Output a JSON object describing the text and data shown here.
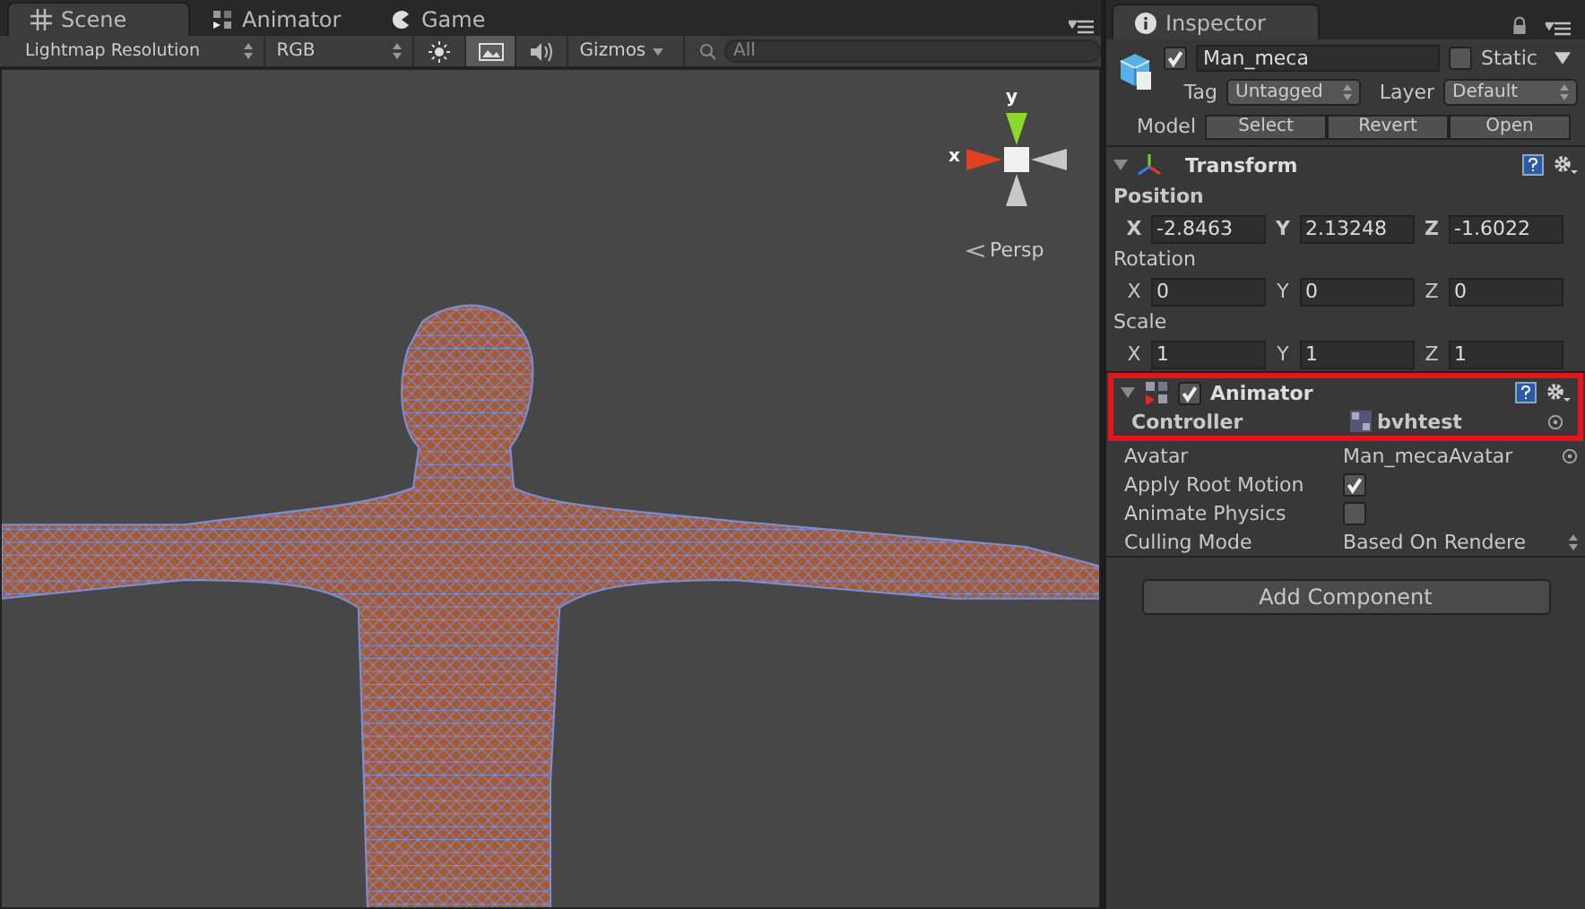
{
  "scene_panel": {
    "tabs": [
      {
        "label": "Scene",
        "selected": true
      },
      {
        "label": "Animator",
        "selected": false
      },
      {
        "label": "Game",
        "selected": false
      }
    ],
    "toolbar": {
      "render_mode": "Lightmap Resolution",
      "color_mode": "RGB",
      "toggles": [
        {
          "on": false
        },
        {
          "on": true
        },
        {
          "on": false
        }
      ],
      "gizmos": "Gizmos",
      "search_placeholder": "All"
    },
    "gizmo": {
      "y_label": "y",
      "x_label": "x",
      "projection": "Persp"
    }
  },
  "inspector": {
    "tab": "Inspector",
    "object": {
      "active": true,
      "name": "Man_meca",
      "static_label": "Static",
      "static": false,
      "tag_label": "Tag",
      "tag": "Untagged",
      "layer_label": "Layer",
      "layer": "Default",
      "model_label": "Model",
      "model_buttons": [
        "Select",
        "Revert",
        "Open"
      ]
    },
    "components": [
      {
        "kind": "transform",
        "title": "Transform",
        "expanded": true,
        "highlighted": false,
        "groups": [
          {
            "label": "Position",
            "modified": true,
            "fields": [
              {
                "axis": "X",
                "value": "-2.8463"
              },
              {
                "axis": "Y",
                "value": "2.13248"
              },
              {
                "axis": "Z",
                "value": "-1.6022"
              }
            ]
          },
          {
            "label": "Rotation",
            "modified": false,
            "fields": [
              {
                "axis": "X",
                "value": "0"
              },
              {
                "axis": "Y",
                "value": "0"
              },
              {
                "axis": "Z",
                "value": "0"
              }
            ]
          },
          {
            "label": "Scale",
            "modified": false,
            "fields": [
              {
                "axis": "X",
                "value": "1"
              },
              {
                "axis": "Y",
                "value": "1"
              },
              {
                "axis": "Z",
                "value": "1"
              }
            ]
          }
        ]
      },
      {
        "kind": "animator",
        "title": "Animator",
        "expanded": true,
        "enabled": true,
        "highlighted": true,
        "properties": [
          {
            "kind": "object",
            "label": "Controller",
            "value": "bvhtest",
            "modified": true
          },
          {
            "kind": "object",
            "label": "Avatar",
            "value": "Man_mecaAvatar",
            "modified": false
          },
          {
            "kind": "checkbox",
            "label": "Apply Root Motion",
            "checked": true
          },
          {
            "kind": "checkbox",
            "label": "Animate Physics",
            "checked": false
          },
          {
            "kind": "dropdown",
            "label": "Culling Mode",
            "value": "Based On Rendere"
          }
        ]
      }
    ],
    "add_component": "Add Component"
  }
}
